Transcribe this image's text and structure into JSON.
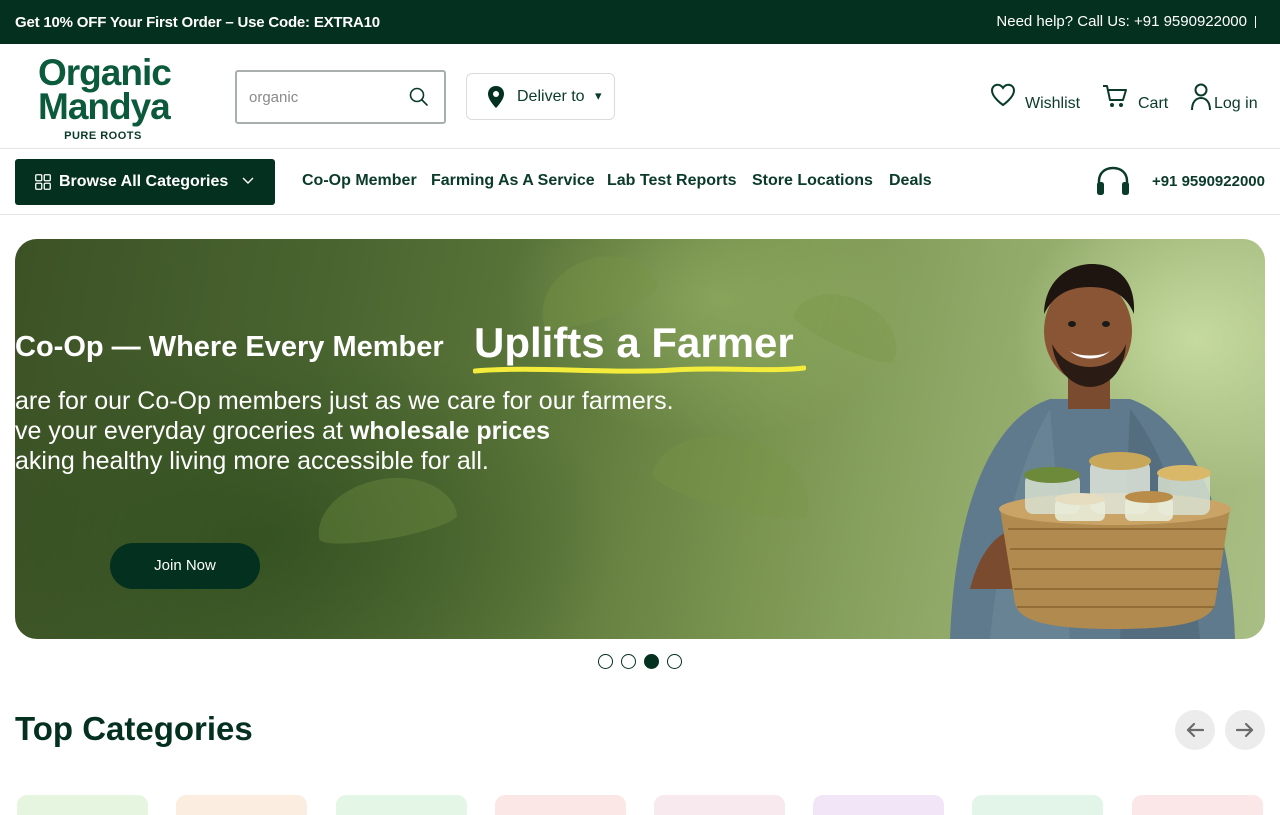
{
  "topbar": {
    "promo": "Get 10% OFF Your First Order – Use Code: EXTRA10",
    "help": "Need help? Call Us: +91 9590922000"
  },
  "logo": {
    "line1": "Organic",
    "line2": "Mandya",
    "tagline": "PURE ROOTS"
  },
  "search": {
    "placeholder": "organic"
  },
  "deliver": {
    "label": "Deliver to",
    "caret": "▾"
  },
  "header_links": {
    "wishlist": "Wishlist",
    "cart": "Cart",
    "login": "Log in"
  },
  "nav": {
    "browse_label": "Browse All Categories",
    "items": [
      "Co-Op Member",
      "Farming As A Service",
      "Lab Test Reports",
      "Store Locations",
      "Deals"
    ],
    "phone": "+91 9590922000"
  },
  "hero": {
    "heading_lead": "Co-Op — Where Every Member",
    "heading_emph": "Uplifts a Farmer",
    "line1": "are for our Co-Op members just as we care for our farmers.",
    "line2_pre": "ve your everyday groceries at ",
    "line2_bold": "wholesale prices",
    "line3": "aking healthy living more accessible for all.",
    "cta": "Join Now",
    "highlight_color": "#f4ec3a"
  },
  "carousel": {
    "slides": 4,
    "active_index": 2
  },
  "sections": {
    "top_categories": "Top Categories"
  },
  "category_card_colors": [
    "#e6f5e0",
    "#fbeee0",
    "#e4f6e6",
    "#fbe7e6",
    "#f8e9ef",
    "#f3e5f8",
    "#e3f4e8",
    "#fbe6e8"
  ],
  "colors": {
    "brand_dark": "#04301f",
    "brand_green": "#0c5a3c"
  }
}
